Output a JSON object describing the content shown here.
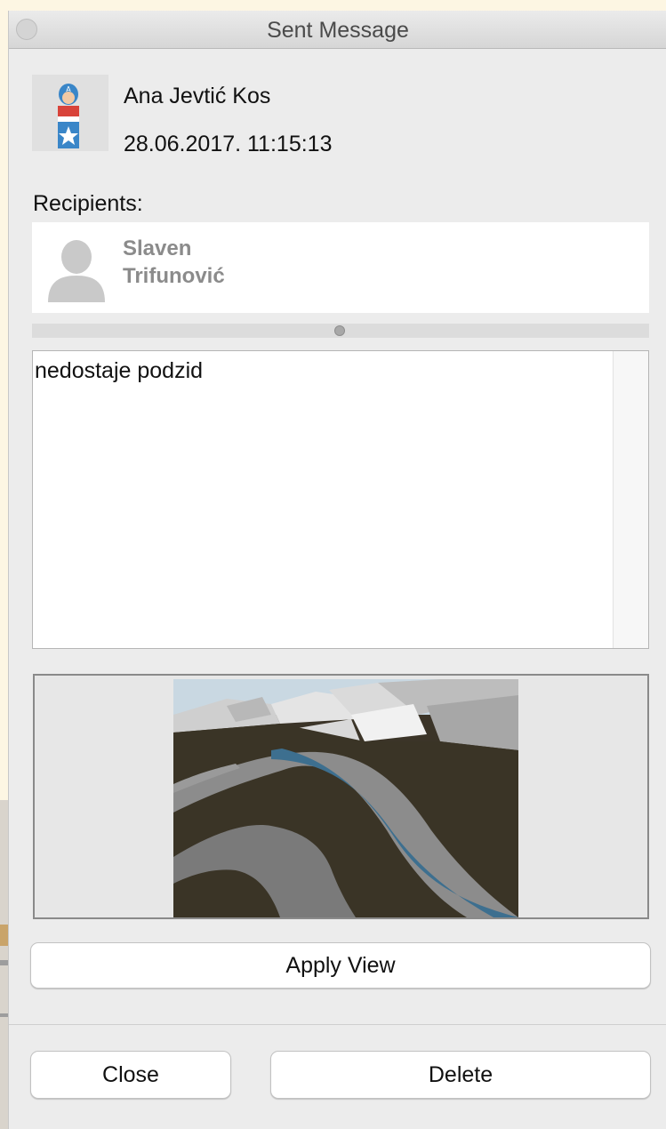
{
  "window": {
    "title": "Sent Message"
  },
  "sender": {
    "name": "Ana Jevtić Kos",
    "datetime": "28.06.2017. 11:15:13"
  },
  "recipients": {
    "label": "Recipients:",
    "items": [
      {
        "first_name": "Slaven",
        "last_name": "Trifunović"
      }
    ]
  },
  "message": {
    "body": "nedostaje podzid"
  },
  "buttons": {
    "apply_view": "Apply View",
    "close": "Close",
    "delete": "Delete"
  },
  "icons": {
    "sender_avatar": "captain-avatar-icon",
    "recipient_avatar": "person-silhouette-icon"
  },
  "colors": {
    "window_bg": "#ececec",
    "avatar_blue": "#3a86c8",
    "wall_blue": "#3d6f8f"
  }
}
